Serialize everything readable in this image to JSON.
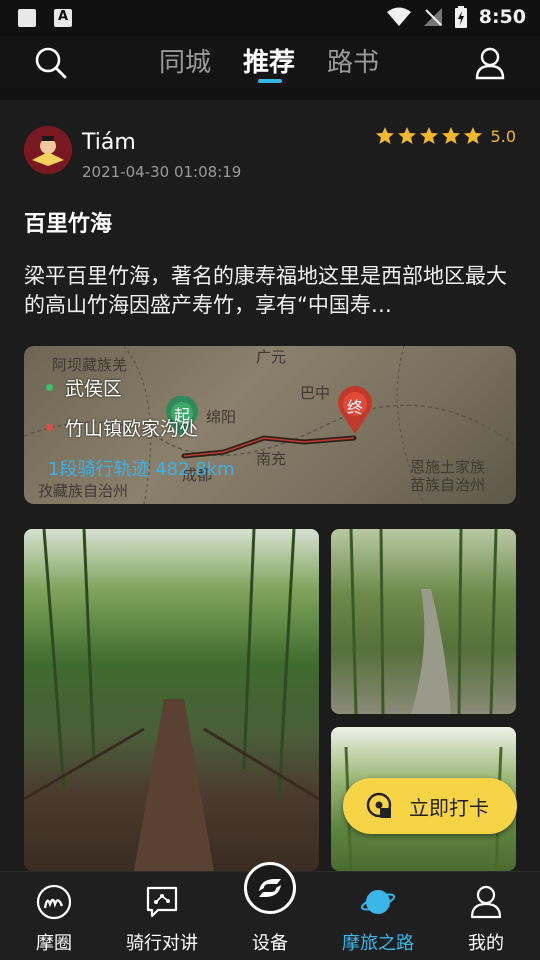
{
  "status_bar": {
    "time": "8:50"
  },
  "top_nav": {
    "tabs": [
      {
        "label": "同城"
      },
      {
        "label": "推荐"
      },
      {
        "label": "路书"
      }
    ],
    "active_tab": "推荐"
  },
  "post": {
    "author": "Tiám",
    "timestamp": "2021-04-30 01:08:19",
    "rating": {
      "stars": 5,
      "score": "5.0"
    },
    "title": "百里竹海",
    "body": "梁平百里竹海，著名的康寿福地这里是西部地区最大的高山竹海因盛产寿竹，享有“中国寿…",
    "route": {
      "start": "武侯区",
      "end": "竹山镇欧家沟处",
      "track": "1段骑行轨迹  482.8km",
      "start_marker": "起",
      "end_marker": "终",
      "map_labels": [
        "阿坝藏族羌",
        "广元",
        "巴中",
        "绵阳",
        "南充",
        "成都",
        "恩施土家族",
        "苗族自治州",
        "孜藏族自治州"
      ]
    }
  },
  "checkin_button": {
    "label": "立即打卡"
  },
  "bottom_nav": {
    "items": [
      {
        "label": "摩圈"
      },
      {
        "label": "骑行对讲"
      },
      {
        "label": "设备"
      },
      {
        "label": "摩旅之路"
      },
      {
        "label": "我的"
      }
    ],
    "active": "摩旅之路"
  },
  "colors": {
    "accent": "#36b6e6",
    "star": "#f3b72c",
    "checkin": "#f7d445",
    "background": "#1c1c1c"
  }
}
